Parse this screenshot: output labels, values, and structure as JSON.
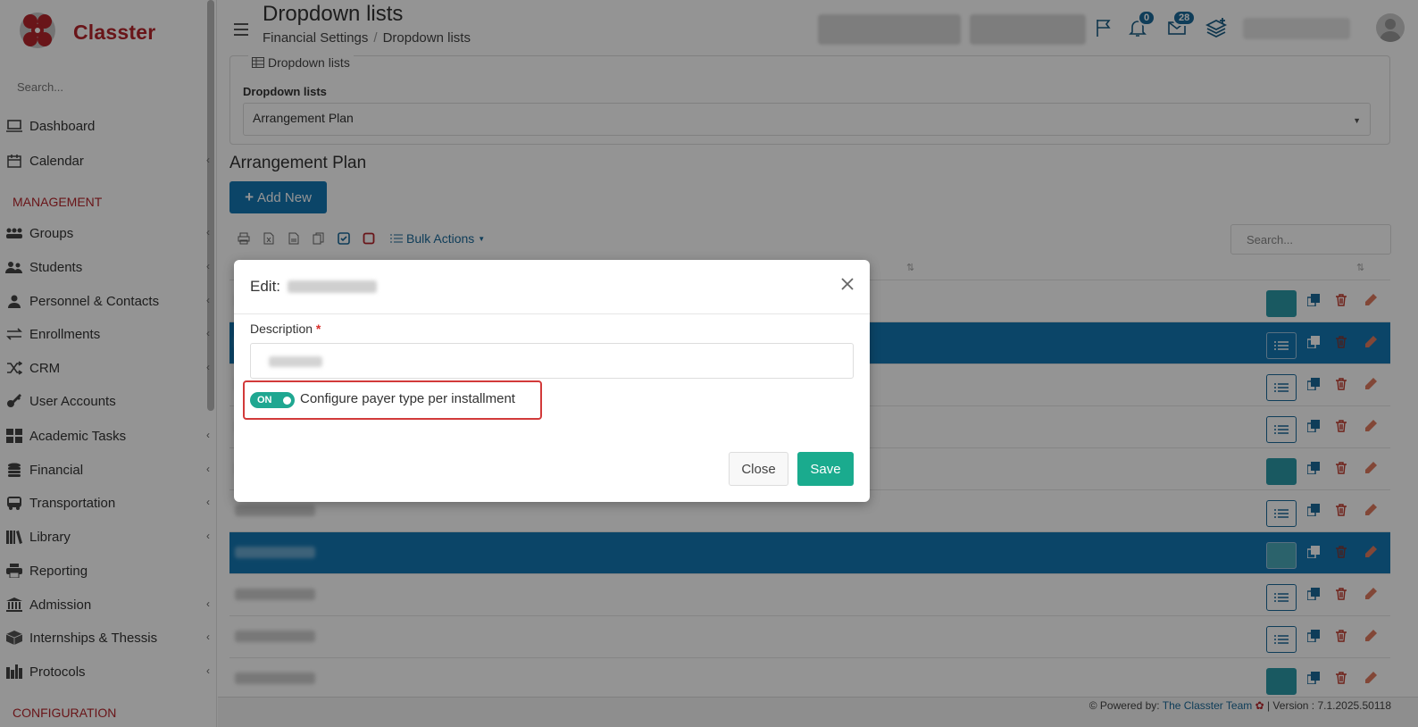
{
  "app": {
    "name": "Classter",
    "logo_icon": "classter-logo-icon"
  },
  "colors": {
    "brand": "#b5252b",
    "primary": "#1478b4",
    "success": "#1aab8e",
    "highlight": "#d23a3a"
  },
  "sidebar": {
    "search_placeholder": "Search...",
    "items": [
      {
        "label": "Dashboard",
        "icon": "laptop-icon",
        "expandable": false
      },
      {
        "label": "Calendar",
        "icon": "calendar-icon",
        "expandable": true
      },
      {
        "label": "Groups",
        "icon": "groups-icon",
        "expandable": true
      },
      {
        "label": "Students",
        "icon": "students-icon",
        "expandable": true
      },
      {
        "label": "Personnel & Contacts",
        "icon": "person-icon",
        "expandable": true
      },
      {
        "label": "Enrollments",
        "icon": "exchange-icon",
        "expandable": true
      },
      {
        "label": "CRM",
        "icon": "shuffle-icon",
        "expandable": true
      },
      {
        "label": "User Accounts",
        "icon": "key-icon",
        "expandable": false
      },
      {
        "label": "Academic Tasks",
        "icon": "grid-icon",
        "expandable": true
      },
      {
        "label": "Financial",
        "icon": "coins-icon",
        "expandable": true
      },
      {
        "label": "Transportation",
        "icon": "bus-icon",
        "expandable": true
      },
      {
        "label": "Library",
        "icon": "books-icon",
        "expandable": true
      },
      {
        "label": "Reporting",
        "icon": "printer-icon",
        "expandable": false
      },
      {
        "label": "Admission",
        "icon": "bank-icon",
        "expandable": true
      },
      {
        "label": "Internships & Thessis",
        "icon": "box-icon",
        "expandable": true
      },
      {
        "label": "Protocols",
        "icon": "protocols-icon",
        "expandable": true
      }
    ],
    "sections": {
      "management": "MANAGEMENT",
      "configuration": "CONFIGURATION"
    }
  },
  "header": {
    "title": "Dropdown lists",
    "breadcrumb": [
      "Financial Settings",
      "Dropdown lists"
    ],
    "notifications_count": "0",
    "messages_count": "28"
  },
  "dropdown_card": {
    "legend": "Dropdown lists",
    "field_label": "Dropdown lists",
    "selected_value": "Arrangement Plan"
  },
  "list": {
    "title": "Arrangement Plan",
    "add_button": "Add New",
    "bulk_actions": "Bulk Actions",
    "search_placeholder": "Search...",
    "rows": [
      {
        "selected": false,
        "first_action": "teal"
      },
      {
        "selected": true,
        "first_action": "list"
      },
      {
        "selected": false,
        "first_action": "list"
      },
      {
        "selected": false,
        "first_action": "list"
      },
      {
        "selected": false,
        "first_action": "teal"
      },
      {
        "selected": false,
        "first_action": "list"
      },
      {
        "selected": true,
        "first_action": "teal"
      },
      {
        "selected": false,
        "first_action": "list"
      },
      {
        "selected": false,
        "first_action": "list"
      },
      {
        "selected": false,
        "first_action": "teal"
      }
    ]
  },
  "footer": {
    "powered_by": "Powered by:",
    "team": "The Classter Team",
    "version": "| Version : 7.1.2025.50118"
  },
  "modal": {
    "title_prefix": "Edit:",
    "description_label": "Description",
    "required_mark": "*",
    "toggle_state": "ON",
    "toggle_label": "Configure payer type per installment",
    "close_button": "Close",
    "save_button": "Save"
  }
}
